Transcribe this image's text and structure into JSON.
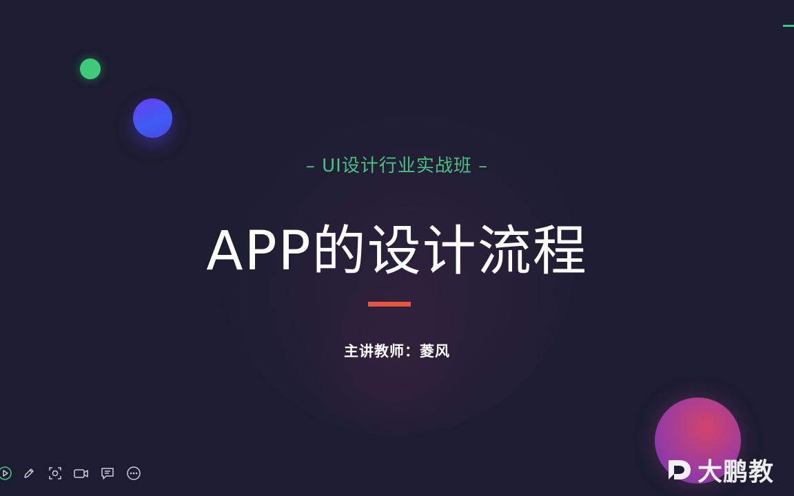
{
  "slide": {
    "subtitle": "– UI设计行业实战班 –",
    "title": "APP的设计流程",
    "presenter": "主讲教师：菱风"
  },
  "toolbar": {
    "items": [
      {
        "icon": "play-icon"
      },
      {
        "icon": "pen-icon"
      },
      {
        "icon": "screenshot-icon"
      },
      {
        "icon": "video-camera-icon"
      },
      {
        "icon": "comment-icon"
      },
      {
        "icon": "more-icon"
      }
    ]
  },
  "watermark": {
    "brand_text": "大鹏教"
  },
  "colors": {
    "background": "#1c1d30",
    "accent_green": "#4cc083",
    "accent_red": "#e8553f",
    "title_white": "#ffffff"
  }
}
